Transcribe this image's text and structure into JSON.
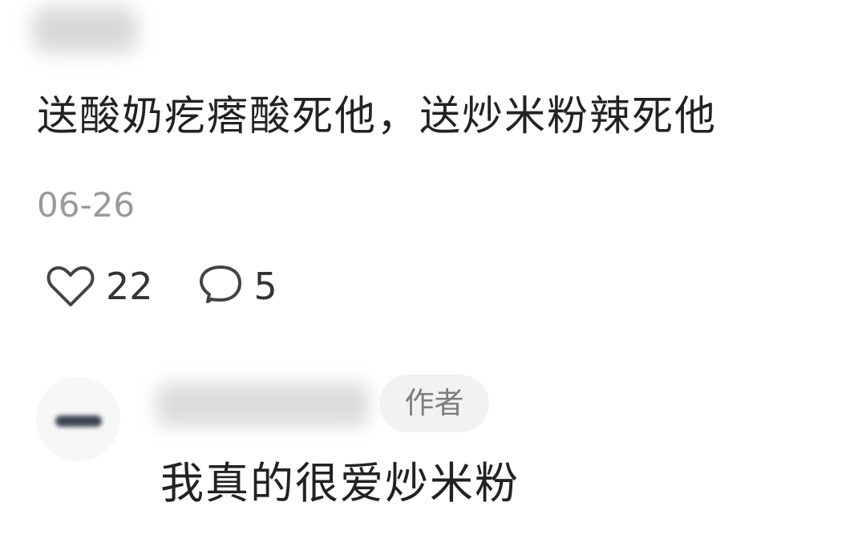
{
  "comment": {
    "text": "送酸奶疙瘩酸死他，送炒米粉辣死他",
    "date": "06-26",
    "like_count": "22",
    "reply_count": "5",
    "like_icon": "heart-outline",
    "reply_icon": "speech-bubble-outline"
  },
  "reply": {
    "author_badge": "作者",
    "text": "我真的很爱炒米粉"
  }
}
